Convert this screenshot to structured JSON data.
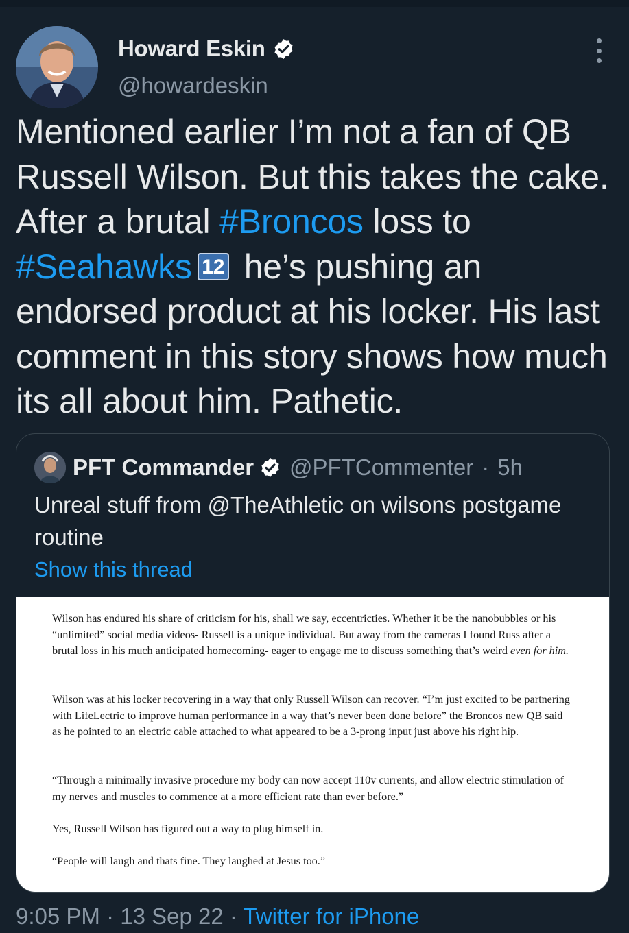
{
  "author": {
    "display_name": "Howard Eskin",
    "handle": "@howardeskin"
  },
  "tweet": {
    "text_1": "Mentioned earlier I’m not a fan of QB Russell Wilson. But this takes the cake. After a brutal ",
    "hashtag_1": "#Broncos",
    "text_2": " loss to ",
    "hashtag_2": "#Seahawks",
    "emoji_12": "12",
    "text_3": "he’s pushing an endorsed product at his locker. His last comment in this story shows how much its all about him. Pathetic."
  },
  "quote": {
    "display_name": "PFT Commander",
    "handle": "@PFTCommenter",
    "separator": "·",
    "time": "5h",
    "text": "Unreal stuff from @TheAthletic on wilsons postgame routine",
    "show_thread": "Show this thread",
    "article": {
      "p1_a": "Wilson has endured his share of criticism for his, shall we say, eccentricties. Whether it be the nanobubbles or his “unlimited” social media videos- Russell is a unique individual. But away from the cameras I found Russ after a brutal loss in his much anticipated homecoming- eager to engage me to discuss something that’s weird ",
      "p1_em": "even for him.",
      "p2": "Wilson was at his locker recovering in a way that only Russell Wilson can recover. “I’m just excited to be partnering with LifeLectric to improve human performance in a way that’s never been done before” the Broncos new QB said as he pointed to an electric cable attached to what appeared to be a 3-prong input just above his right hip.",
      "p3": "“Through a minimally invasive procedure my body can now accept 110v currents, and allow electric stimulation of my nerves and muscles to commence at a more efficient rate than ever before.”",
      "p4": "Yes, Russell Wilson has figured out a way to plug himself in.",
      "p5": "“People will laugh and thats fine. They laughed at Jesus too.”"
    }
  },
  "footer": {
    "time": "9:05 PM",
    "sep1": "·",
    "date": "13 Sep 22",
    "sep2": "·",
    "source": "Twitter for iPhone"
  },
  "colors": {
    "background": "#15202b",
    "link": "#1d9bf0",
    "secondary_text": "#8b98a5"
  }
}
